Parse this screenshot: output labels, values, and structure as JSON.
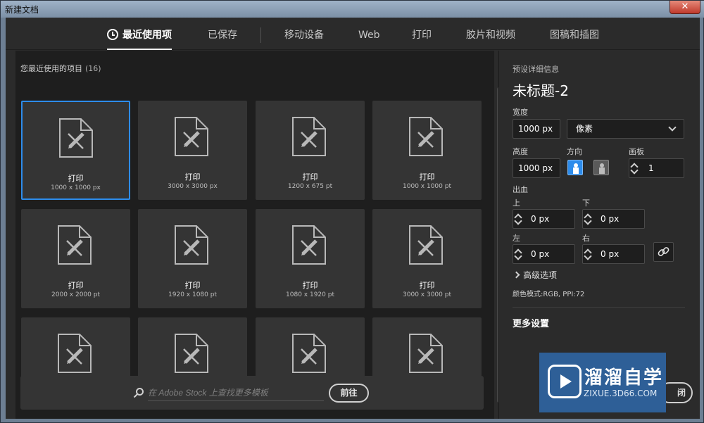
{
  "window": {
    "title": "新建文档",
    "close_label": "✕"
  },
  "tabs": [
    {
      "label": "最近使用项",
      "active": true
    },
    {
      "label": "已保存"
    },
    {
      "label": "移动设备"
    },
    {
      "label": "Web"
    },
    {
      "label": "打印"
    },
    {
      "label": "胶片和视频"
    },
    {
      "label": "图稿和插图"
    }
  ],
  "recent": {
    "header": "您最近使用的项目",
    "count": "(16)",
    "cards": [
      {
        "name": "打印",
        "size": "1000 x 1000 px",
        "selected": true
      },
      {
        "name": "打印",
        "size": "3000 x 3000 px"
      },
      {
        "name": "打印",
        "size": "1200 x 675 pt"
      },
      {
        "name": "打印",
        "size": "1000 x 1000 pt"
      },
      {
        "name": "打印",
        "size": "2000 x 2000 pt"
      },
      {
        "name": "打印",
        "size": "1920 x 1080 pt"
      },
      {
        "name": "打印",
        "size": "1080 x 1920 pt"
      },
      {
        "name": "打印",
        "size": "3000 x 3000 pt"
      },
      {
        "name": "",
        "size": ""
      },
      {
        "name": "",
        "size": ""
      },
      {
        "name": "",
        "size": ""
      },
      {
        "name": "",
        "size": ""
      }
    ]
  },
  "stock": {
    "placeholder": "在 Adobe Stock 上查找更多模板",
    "go_label": "前往"
  },
  "details": {
    "header": "预设详细信息",
    "doc_title": "未标题-2",
    "width_label": "宽度",
    "width_value": "1000 px",
    "unit_value": "像素",
    "height_label": "高度",
    "height_value": "1000 px",
    "orientation_label": "方向",
    "artboard_label": "画板",
    "artboard_value": "1",
    "bleed_label": "出血",
    "top_label": "上",
    "top_value": "0 px",
    "bottom_label": "下",
    "bottom_value": "0 px",
    "left_label": "左",
    "left_value": "0 px",
    "right_label": "右",
    "right_value": "0 px",
    "advanced_label": "高级选项",
    "color_mode": "颜色模式:RGB, PPI:72",
    "more_settings": "更多设置",
    "partial_button": "闭"
  },
  "watermark": {
    "cn": "溜溜自学",
    "url": "ZIXUE.3D66.COM"
  },
  "colors": {
    "accent": "#2d8ceb",
    "panel": "#1e1e1e",
    "card": "#343434",
    "watermark": "#2e5f97"
  }
}
